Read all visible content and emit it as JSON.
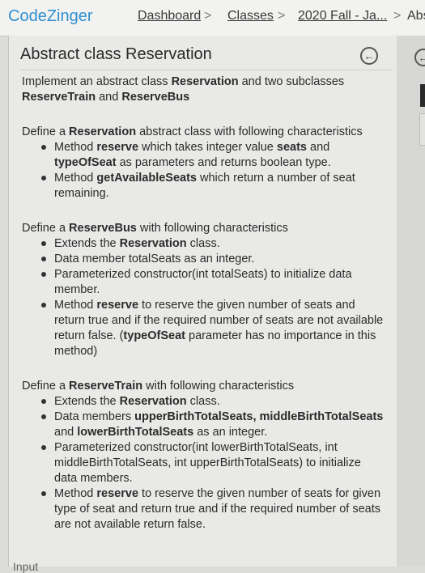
{
  "header": {
    "logo": "CodeZinger",
    "breadcrumbs": [
      "Dashboard",
      "Classes",
      "2020 Fall - Ja...",
      "Abs"
    ],
    "separator": ">"
  },
  "problem": {
    "title": "Abstract class Reservation",
    "intro": [
      {
        "t": "Implement an abstract class "
      },
      {
        "t": "Reservation",
        "b": true
      },
      {
        "t": " and two subclasses "
      },
      {
        "t": "ReserveTrain",
        "b": true
      },
      {
        "t": " and "
      },
      {
        "t": "ReserveBus",
        "b": true
      }
    ],
    "sections": [
      {
        "heading": [
          {
            "t": "Define a "
          },
          {
            "t": "Reservation",
            "b": true
          },
          {
            "t": " abstract class with following characteristics"
          }
        ],
        "items": [
          [
            {
              "t": "Method "
            },
            {
              "t": "reserve",
              "b": true
            },
            {
              "t": " which takes integer value "
            },
            {
              "t": "seats",
              "b": true
            },
            {
              "t": " and "
            },
            {
              "t": "typeOfSeat",
              "b": true
            },
            {
              "t": " as parameters and returns boolean type."
            }
          ],
          [
            {
              "t": "Method "
            },
            {
              "t": "getAvailableSeats",
              "b": true
            },
            {
              "t": " which return a number of seat remaining."
            }
          ]
        ]
      },
      {
        "heading": [
          {
            "t": "Define a "
          },
          {
            "t": "ReserveBus",
            "b": true
          },
          {
            "t": " with following characteristics"
          }
        ],
        "items": [
          [
            {
              "t": "Extends the "
            },
            {
              "t": "Reservation",
              "b": true
            },
            {
              "t": " class."
            }
          ],
          [
            {
              "t": "Data member totalSeats as an integer."
            }
          ],
          [
            {
              "t": "Parameterized constructor(int totalSeats) to initialize data member."
            }
          ],
          [
            {
              "t": "Method "
            },
            {
              "t": "reserve",
              "b": true
            },
            {
              "t": " to reserve the given number of seats and return true and if the required number of seats are not available return false. ("
            },
            {
              "t": "typeOfSeat",
              "b": true
            },
            {
              "t": " parameter has no importance in this method)"
            }
          ]
        ]
      },
      {
        "heading": [
          {
            "t": "Define a "
          },
          {
            "t": "ReserveTrain",
            "b": true
          },
          {
            "t": " with following characteristics"
          }
        ],
        "items": [
          [
            {
              "t": "Extends the "
            },
            {
              "t": "Reservation",
              "b": true
            },
            {
              "t": " class."
            }
          ],
          [
            {
              "t": "Data members "
            },
            {
              "t": "upperBirthTotalSeats, middleBirthTotalSeats",
              "b": true
            },
            {
              "t": " and "
            },
            {
              "t": "lowerBirthTotalSeats",
              "b": true
            },
            {
              "t": " as an integer."
            }
          ],
          [
            {
              "t": "Parameterized constructor(int lowerBirthTotalSeats, int middleBirthTotalSeats, int upperBirthTotalSeats) to initialize data members."
            }
          ],
          [
            {
              "t": "Method "
            },
            {
              "t": "reserve",
              "b": true
            },
            {
              "t": " to reserve the given number of seats for given type of seat and return true and if the required number of seats are not available return false."
            }
          ]
        ]
      }
    ],
    "next_heading": "Input"
  }
}
